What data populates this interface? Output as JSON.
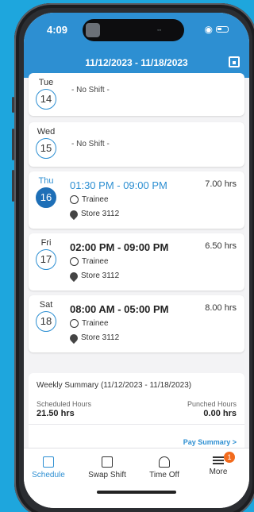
{
  "status": {
    "time": "4:09",
    "wifi_icon": "wifi-icon",
    "battery_icon": "battery-icon"
  },
  "header": {
    "date_range": "11/12/2023 - 11/18/2023",
    "calendar_icon": "calendar-icon"
  },
  "days": [
    {
      "day": "Tue",
      "date": "14",
      "text": "- No Shift -"
    },
    {
      "day": "Wed",
      "date": "15",
      "text": "- No Shift -"
    },
    {
      "day": "Thu",
      "date": "16",
      "time": "01:30 PM - 09:00 PM",
      "hours": "7.00 hrs",
      "role": "Trainee",
      "store": "Store 3112"
    },
    {
      "day": "Fri",
      "date": "17",
      "time": "02:00 PM - 09:00 PM",
      "hours": "6.50 hrs",
      "role": "Trainee",
      "store": "Store 3112"
    },
    {
      "day": "Sat",
      "date": "18",
      "time": "08:00 AM - 05:00 PM",
      "hours": "8.00 hrs",
      "role": "Trainee",
      "store": "Store 3112"
    }
  ],
  "summary": {
    "title": "Weekly Summary (11/12/2023 - 11/18/2023)",
    "scheduled_label": "Scheduled Hours",
    "scheduled_value": "21.50 hrs",
    "punched_label": "Punched Hours",
    "punched_value": "0.00 hrs",
    "pay_link": "Pay Summary >"
  },
  "tabs": [
    {
      "label": "Schedule",
      "icon": "schedule-icon"
    },
    {
      "label": "Swap Shift",
      "icon": "swap-shift-icon"
    },
    {
      "label": "Time Off",
      "icon": "time-off-icon"
    },
    {
      "label": "More",
      "icon": "menu-icon",
      "badge": "1"
    }
  ],
  "colors": {
    "brand_blue": "#2d8fd2",
    "active_date": "#1e6fb7",
    "badge_orange": "#f26b1d"
  }
}
